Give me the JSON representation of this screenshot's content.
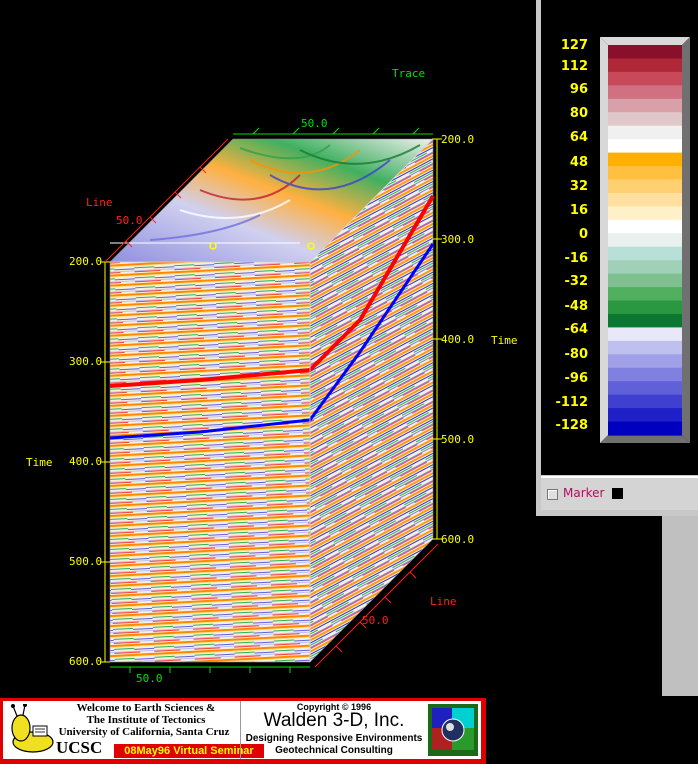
{
  "axes": {
    "trace_label": "Trace",
    "trace_tick": "50.0",
    "line_label_top": "Line",
    "line_tick_top": "50.0",
    "line_label_bottom": "Line",
    "line_tick_bottom": "50.0",
    "front_bottom_tick": "50.0",
    "time_label_left": "Time",
    "time_label_right": "Time",
    "left_time_ticks": [
      "200.0",
      "300.0",
      "400.0",
      "500.0",
      "600.0"
    ],
    "right_time_ticks": [
      "200.0",
      "300.0",
      "400.0",
      "500.0",
      "600.0"
    ]
  },
  "colorbar": {
    "ticks": [
      "127",
      "112",
      "96",
      "80",
      "64",
      "48",
      "32",
      "16",
      "0",
      "-16",
      "-32",
      "-48",
      "-64",
      "-80",
      "-96",
      "-112",
      "-128"
    ],
    "colors": [
      "#8a0f2a",
      "#b02838",
      "#c84a5a",
      "#d07080",
      "#d8a0a8",
      "#e0c8c8",
      "#f0f0f0",
      "#ffffff",
      "#ffb000",
      "#ffc040",
      "#ffd070",
      "#ffe0a0",
      "#fff0c8",
      "#ffffff",
      "#e8f0f0",
      "#b8e0d8",
      "#a0d0b8",
      "#80c090",
      "#50b060",
      "#2a9840",
      "#0a7830",
      "#e8e8f8",
      "#c0c0f0",
      "#a0a0e8",
      "#8080e0",
      "#6060d8",
      "#4040d0",
      "#2020c8",
      "#0000c0"
    ],
    "marker_label": "Marker"
  },
  "banner": {
    "welcome_line1": "Welcome to Earth Sciences &",
    "welcome_line2": "The Institute of Tectonics",
    "welcome_line3": "University of California, Santa Cruz",
    "ucsc": "UCSC",
    "seminar": "08May96 Virtual Seminar",
    "copyright": "Copyright © 1996",
    "company": "Walden 3-D, Inc.",
    "tagline1": "Designing Responsive Environments",
    "tagline2": "Geotechnical Consulting"
  },
  "colors": {
    "horizon_red": "#ff0000",
    "horizon_blue": "#0000ff",
    "axis_yellow": "#ffff00",
    "axis_green": "#00e000",
    "axis_red": "#ff2020"
  }
}
